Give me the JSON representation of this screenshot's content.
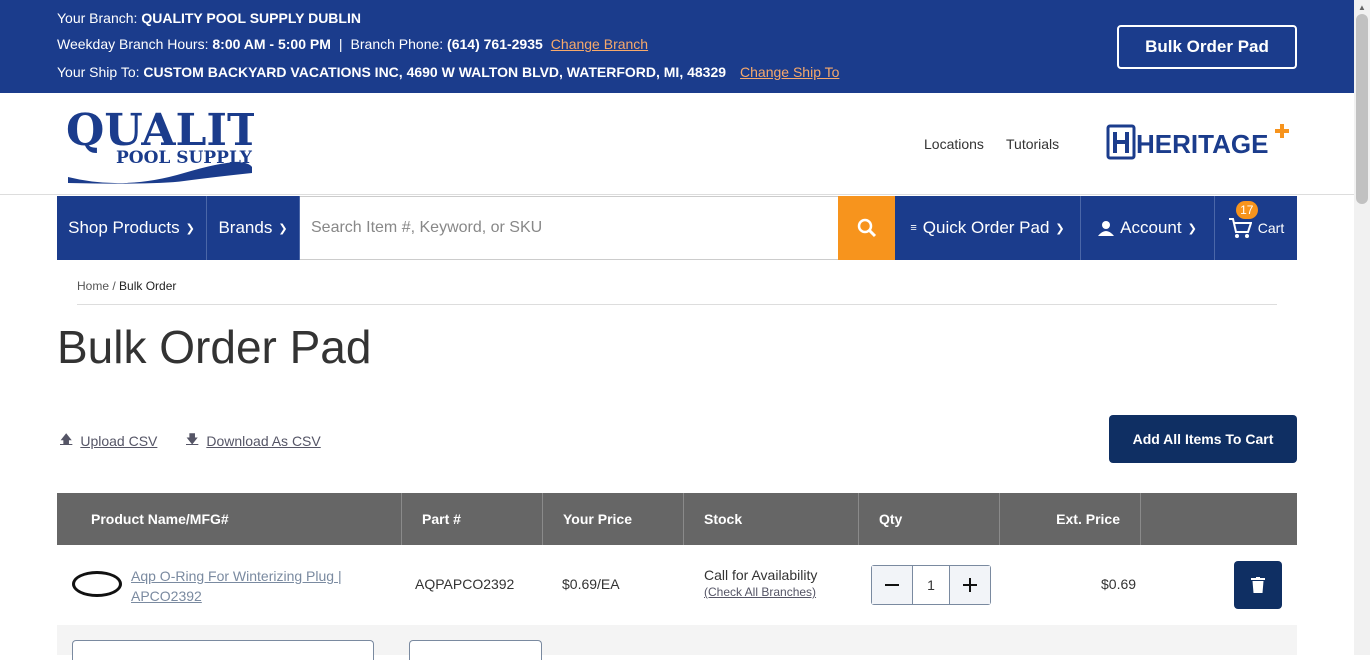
{
  "topbar": {
    "branch_label": "Your Branch: ",
    "branch_name": "QUALITY POOL SUPPLY DUBLIN",
    "hours_label": "Weekday Branch Hours: ",
    "hours_value": "8:00 AM - 5:00 PM",
    "separator": "|",
    "phone_label": "Branch Phone: ",
    "phone_value": "(614) 761-2935",
    "change_branch": "Change Branch",
    "shipto_label": "Your Ship To: ",
    "shipto_value": "CUSTOM BACKYARD VACATIONS INC, 4690 W WALTON BLVD, WATERFORD, MI, 48329",
    "change_shipto": "Change Ship To",
    "bulk_order_pad": "Bulk Order Pad"
  },
  "header": {
    "logo_line1": "QUALITY",
    "logo_line2": "POOL SUPPLY",
    "links": [
      "Locations",
      "Tutorials"
    ],
    "partner_logo": "HERITAGE"
  },
  "nav": {
    "shop_products": "Shop Products",
    "brands": "Brands",
    "search_placeholder": "Search Item #, Keyword, or SKU",
    "quick_order_pad": "Quick Order Pad",
    "account": "Account",
    "cart": "Cart",
    "cart_count": "17"
  },
  "breadcrumb": {
    "home": "Home",
    "sep": " / ",
    "current": "Bulk Order"
  },
  "page": {
    "title": "Bulk Order Pad",
    "upload_csv": "Upload CSV",
    "download_csv": "Download As CSV",
    "add_all": "Add All Items To Cart"
  },
  "table": {
    "headers": [
      "Product Name/MFG#",
      "Part #",
      "Your Price",
      "Stock",
      "Qty",
      "Ext. Price"
    ],
    "rows": [
      {
        "name": "Aqp O-Ring For Winterizing Plug | APCO2392",
        "part": "AQPAPCO2392",
        "price": "$0.69/EA",
        "stock": "Call for Availability",
        "stock_link": "(Check All Branches)",
        "qty": "1",
        "ext_price": "$0.69"
      }
    ]
  },
  "colors": {
    "brand_blue": "#1b3c8c",
    "accent_orange": "#f7941d",
    "dark_navy": "#0f2f63"
  }
}
